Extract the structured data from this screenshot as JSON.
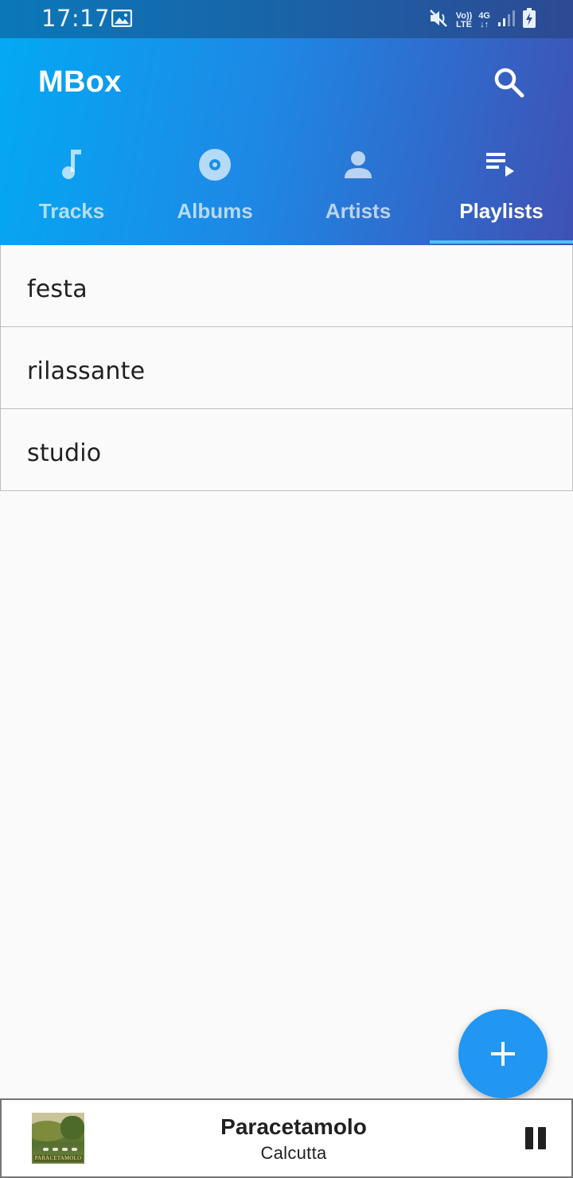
{
  "status_bar": {
    "time": "17:17",
    "icons": [
      "image-icon",
      "mute-icon",
      "volte-icon",
      "4g-icon",
      "signal-icon",
      "battery-charging-icon"
    ],
    "volte_top": "Vo))",
    "volte_bottom": "LTE",
    "network": "4G"
  },
  "app_bar": {
    "title": "MBox",
    "search_icon": "search-icon",
    "background_colors": [
      "#03a9f4",
      "#3f51b5"
    ]
  },
  "tabs": [
    {
      "label": "Tracks",
      "icon": "music-note-icon",
      "active": false
    },
    {
      "label": "Albums",
      "icon": "album-icon",
      "active": false
    },
    {
      "label": "Artists",
      "icon": "person-icon",
      "active": false
    },
    {
      "label": "Playlists",
      "icon": "playlist-play-icon",
      "active": true
    }
  ],
  "playlists": [
    {
      "name": "festa"
    },
    {
      "name": "rilassante"
    },
    {
      "name": "studio"
    }
  ],
  "fab": {
    "icon": "add-icon",
    "color": "#2196f3"
  },
  "player": {
    "title": "Paracetamolo",
    "artist": "Calcutta",
    "album_art_text": "PARACETAMOLO",
    "control_icon": "pause-icon"
  }
}
